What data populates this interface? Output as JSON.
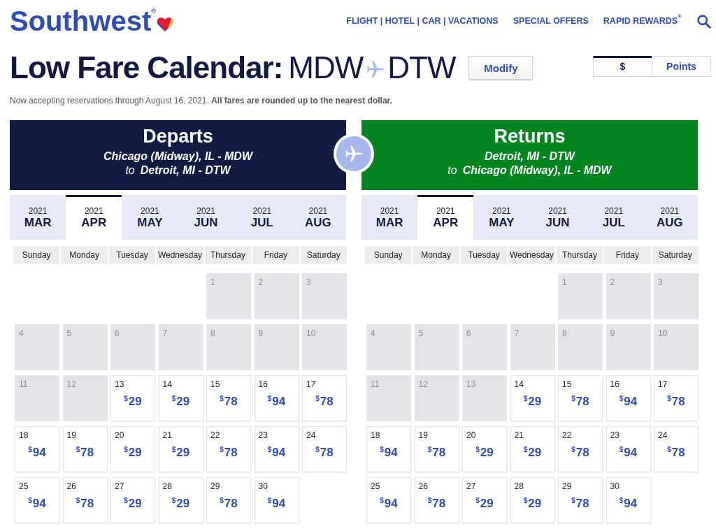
{
  "header": {
    "logo": "Southwest$^{®}$",
    "nav": [
      "FLIGHT | HOTEL | CAR | VACATIONS",
      "SPECIAL OFFERS",
      "RAPID REWARDS$^{®}$"
    ]
  },
  "title": {
    "heading": "Low Fare Calendar:",
    "origin": "MDW",
    "destination": "DTW"
  },
  "modify_button": "Modify",
  "fare_type": [
    {
      "label": "$",
      "selected": true
    },
    {
      "label": "Points",
      "selected": false
    }
  ],
  "notice": "Now accepting reservations through August 16, 2021. **All fares are rounded up to the nearest dollar.**",
  "panels": [
    {
      "title": "Departs",
      "color": "#121c42",
      "from": "Chicago (Midway), IL - MDW",
      "connector": "to",
      "to": "Detroit, MI - DTW",
      "months": [
        {
          "year": "2021",
          "month": "MAR",
          "selected": false
        },
        {
          "year": "2021",
          "month": "APR",
          "selected": true
        },
        {
          "year": "2021",
          "month": "MAY",
          "selected": false
        },
        {
          "year": "2021",
          "month": "JUN",
          "selected": false
        },
        {
          "year": "2021",
          "month": "JUL",
          "selected": false
        },
        {
          "year": "2021",
          "month": "AUG",
          "selected": false
        }
      ],
      "weekdays": [
        "Sunday",
        "Monday",
        "Tuesday",
        "Wednesday",
        "Thursday",
        "Friday",
        "Saturday"
      ],
      "weeks": [
        [
          {
            "day": "1",
            "available": false
          },
          {
            "day": "2",
            "available": false
          },
          {
            "day": "3",
            "available": false
          }
        ],
        [
          {
            "day": "4",
            "available": false
          },
          {
            "day": "5",
            "available": false
          },
          {
            "day": "6",
            "available": false
          },
          {
            "day": "7",
            "available": false
          },
          {
            "day": "8",
            "available": false
          },
          {
            "day": "9",
            "available": false
          },
          {
            "day": "10",
            "available": false
          }
        ],
        [
          {
            "day": "11",
            "available": false
          },
          {
            "day": "12",
            "available": false
          },
          {
            "day": "13",
            "available": true,
            "fare": {
              "currency": "$",
              "amount": "29"
            }
          },
          {
            "day": "14",
            "available": true,
            "fare": {
              "currency": "$",
              "amount": "29"
            }
          },
          {
            "day": "15",
            "available": true,
            "fare": {
              "currency": "$",
              "amount": "78"
            }
          },
          {
            "day": "16",
            "available": true,
            "fare": {
              "currency": "$",
              "amount": "94"
            }
          },
          {
            "day": "17",
            "available": true,
            "fare": {
              "currency": "$",
              "amount": "78"
            }
          }
        ],
        [
          {
            "day": "18",
            "available": true,
            "fare": {
              "currency": "$",
              "amount": "94"
            }
          },
          {
            "day": "19",
            "available": true,
            "fare": {
              "currency": "$",
              "amount": "78"
            }
          },
          {
            "day": "20",
            "available": true,
            "fare": {
              "currency": "$",
              "amount": "29"
            }
          },
          {
            "day": "21",
            "available": true,
            "fare": {
              "currency": "$",
              "amount": "29"
            }
          },
          {
            "day": "22",
            "available": true,
            "fare": {
              "currency": "$",
              "amount": "78"
            }
          },
          {
            "day": "23",
            "available": true,
            "fare": {
              "currency": "$",
              "amount": "94"
            }
          },
          {
            "day": "24",
            "available": true,
            "fare": {
              "currency": "$",
              "amount": "78"
            }
          }
        ],
        [
          {
            "day": "25",
            "available": true,
            "fare": {
              "currency": "$",
              "amount": "94"
            }
          },
          {
            "day": "26",
            "available": true,
            "fare": {
              "currency": "$",
              "amount": "78"
            }
          },
          {
            "day": "27",
            "available": true,
            "fare": {
              "currency": "$",
              "amount": "29"
            }
          },
          {
            "day": "28",
            "available": true,
            "fare": {
              "currency": "$",
              "amount": "29"
            }
          },
          {
            "day": "29",
            "available": true,
            "fare": {
              "currency": "$",
              "amount": "78"
            }
          },
          {
            "day": "30",
            "available": true,
            "fare": {
              "currency": "$",
              "amount": "94"
            }
          }
        ]
      ]
    },
    {
      "title": "Returns",
      "color": "#00841f",
      "from": "Detroit, MI - DTW",
      "connector": "to",
      "to": "Chicago (Midway), IL - MDW",
      "months": [
        {
          "year": "2021",
          "month": "MAR",
          "selected": false
        },
        {
          "year": "2021",
          "month": "APR",
          "selected": true
        },
        {
          "year": "2021",
          "month": "MAY",
          "selected": false
        },
        {
          "year": "2021",
          "month": "JUN",
          "selected": false
        },
        {
          "year": "2021",
          "month": "JUL",
          "selected": false
        },
        {
          "year": "2021",
          "month": "AUG",
          "selected": false
        }
      ],
      "weekdays": [
        "Sunday",
        "Monday",
        "Tuesday",
        "Wednesday",
        "Thursday",
        "Friday",
        "Saturday"
      ],
      "weeks": [
        [
          {
            "day": "1",
            "available": false
          },
          {
            "day": "2",
            "available": false
          },
          {
            "day": "3",
            "available": false
          }
        ],
        [
          {
            "day": "4",
            "available": false
          },
          {
            "day": "5",
            "available": false
          },
          {
            "day": "6",
            "available": false
          },
          {
            "day": "7",
            "available": false
          },
          {
            "day": "8",
            "available": false
          },
          {
            "day": "9",
            "available": false
          },
          {
            "day": "10",
            "available": false
          }
        ],
        [
          {
            "day": "11",
            "available": false
          },
          {
            "day": "12",
            "available": false
          },
          {
            "day": "13",
            "available": false
          },
          {
            "day": "14",
            "available": true,
            "fare": {
              "currency": "$",
              "amount": "29"
            }
          },
          {
            "day": "15",
            "available": true,
            "fare": {
              "currency": "$",
              "amount": "78"
            }
          },
          {
            "day": "16",
            "available": true,
            "fare": {
              "currency": "$",
              "amount": "94"
            }
          },
          {
            "day": "17",
            "available": true,
            "fare": {
              "currency": "$",
              "amount": "78"
            }
          }
        ],
        [
          {
            "day": "18",
            "available": true,
            "fare": {
              "currency": "$",
              "amount": "94"
            }
          },
          {
            "day": "19",
            "available": true,
            "fare": {
              "currency": "$",
              "amount": "78"
            }
          },
          {
            "day": "20",
            "available": true,
            "fare": {
              "currency": "$",
              "amount": "29"
            }
          },
          {
            "day": "21",
            "available": true,
            "fare": {
              "currency": "$",
              "amount": "29"
            }
          },
          {
            "day": "22",
            "available": true,
            "fare": {
              "currency": "$",
              "amount": "78"
            }
          },
          {
            "day": "23",
            "available": true,
            "fare": {
              "currency": "$",
              "amount": "94"
            }
          },
          {
            "day": "24",
            "available": true,
            "fare": {
              "currency": "$",
              "amount": "78"
            }
          }
        ],
        [
          {
            "day": "25",
            "available": true,
            "fare": {
              "currency": "$",
              "amount": "94"
            }
          },
          {
            "day": "26",
            "available": true,
            "fare": {
              "currency": "$",
              "amount": "78"
            }
          },
          {
            "day": "27",
            "available": true,
            "fare": {
              "currency": "$",
              "amount": "29"
            }
          },
          {
            "day": "28",
            "available": true,
            "fare": {
              "currency": "$",
              "amount": "29"
            }
          },
          {
            "day": "29",
            "available": true,
            "fare": {
              "currency": "$",
              "amount": "78"
            }
          },
          {
            "day": "30",
            "available": true,
            "fare": {
              "currency": "$",
              "amount": "94"
            }
          }
        ]
      ]
    }
  ]
}
